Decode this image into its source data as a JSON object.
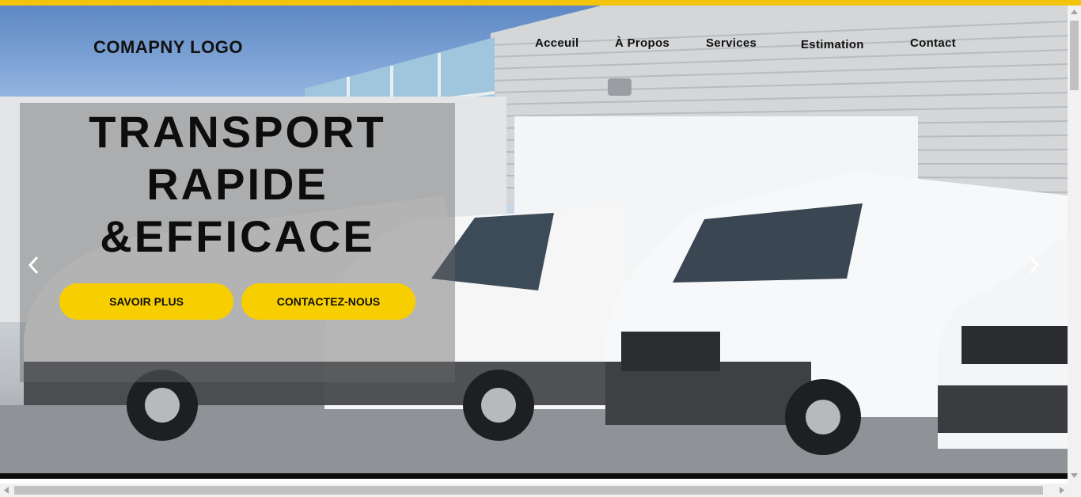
{
  "colors": {
    "accent": "#f7cf00",
    "topbar": "#f2c40c"
  },
  "header": {
    "logo": "COMAPNY LOGO",
    "nav": [
      "Acceuil",
      "À Propos",
      "Services",
      "Estimation",
      "Contact"
    ]
  },
  "hero": {
    "headline": [
      "TRANSPORT",
      "RAPIDE",
      "&EFFICACE"
    ],
    "buttons": {
      "primary": "SAVOIR PLUS",
      "secondary": "CONTACTEZ-NOUS"
    },
    "icons": {
      "prev": "chevron-left-icon",
      "next": "chevron-right-icon"
    }
  }
}
